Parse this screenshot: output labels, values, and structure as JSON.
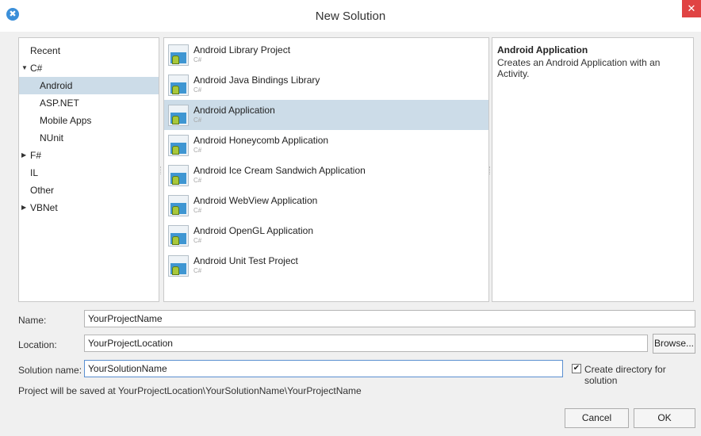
{
  "window": {
    "title": "New Solution",
    "close_glyph": "✕",
    "app_icon_glyph": "✖"
  },
  "categories": [
    {
      "label": "Recent",
      "indent": 0,
      "arrow": "",
      "selected": false
    },
    {
      "label": "C#",
      "indent": 0,
      "arrow": "▼",
      "selected": false
    },
    {
      "label": "Android",
      "indent": 1,
      "arrow": "",
      "selected": true
    },
    {
      "label": "ASP.NET",
      "indent": 1,
      "arrow": "",
      "selected": false
    },
    {
      "label": "Mobile Apps",
      "indent": 1,
      "arrow": "",
      "selected": false
    },
    {
      "label": "NUnit",
      "indent": 1,
      "arrow": "",
      "selected": false
    },
    {
      "label": "F#",
      "indent": 0,
      "arrow": "▶",
      "selected": false
    },
    {
      "label": "IL",
      "indent": 0,
      "arrow": "",
      "selected": false
    },
    {
      "label": "Other",
      "indent": 0,
      "arrow": "",
      "selected": false
    },
    {
      "label": "VBNet",
      "indent": 0,
      "arrow": "▶",
      "selected": false
    }
  ],
  "templates": [
    {
      "name": "Android Library Project",
      "lang": "C#",
      "selected": false
    },
    {
      "name": "Android Java Bindings Library",
      "lang": "C#",
      "selected": false
    },
    {
      "name": "Android Application",
      "lang": "C#",
      "selected": true
    },
    {
      "name": "Android Honeycomb Application",
      "lang": "C#",
      "selected": false
    },
    {
      "name": "Android Ice Cream Sandwich Application",
      "lang": "C#",
      "selected": false
    },
    {
      "name": "Android WebView Application",
      "lang": "C#",
      "selected": false
    },
    {
      "name": "Android OpenGL Application",
      "lang": "C#",
      "selected": false
    },
    {
      "name": "Android Unit Test Project",
      "lang": "C#",
      "selected": false
    }
  ],
  "description": {
    "title": "Android Application",
    "text": "Creates an Android Application with an Activity."
  },
  "form": {
    "name_label": "Name:",
    "name_value": "YourProjectName",
    "location_label": "Location:",
    "location_value": "YourProjectLocation",
    "browse_label": "Browse...",
    "solution_label": "Solution name:",
    "solution_value": "YourSolutionName",
    "create_dir_label": "Create directory for solution",
    "create_dir_checked": true,
    "check_glyph": "✔",
    "info_text": "Project will be saved at YourProjectLocation\\YourSolutionName\\YourProjectName"
  },
  "buttons": {
    "cancel": "Cancel",
    "ok": "OK"
  },
  "colors": {
    "selection": "#ccdce8",
    "close": "#e04343",
    "accent": "#3b8fd9"
  }
}
